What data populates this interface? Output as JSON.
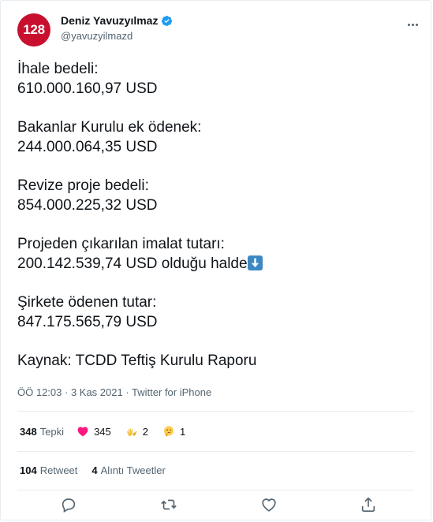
{
  "author": {
    "avatar_text": "128",
    "name": "Deniz Yavuzyılmaz",
    "handle": "@yavuzyilmazd"
  },
  "tweet": {
    "paragraphs": [
      "İhale bedeli:\n610.000.160,97 USD",
      "Bakanlar Kurulu ek ödenek:\n244.000.064,35 USD",
      "Revize proje bedeli:\n854.000.225,32 USD"
    ],
    "para4_line1": "Projeden çıkarılan imalat tutarı:",
    "para4_line2": "200.142.539,74 USD olduğu halde",
    "para5": "Şirkete ödenen tutar:\n847.175.565,79 USD",
    "para6": "Kaynak: TCDD Teftiş Kurulu Raporu"
  },
  "meta": {
    "time": "ÖÖ 12:03",
    "dot": " · ",
    "date": "3 Kas 2021",
    "source": "Twitter for iPhone"
  },
  "reactions": {
    "total_count": "348",
    "total_label": "Tepki",
    "heart_count": "345",
    "clap_count": "2",
    "thinking_count": "1"
  },
  "retweets": {
    "retweet_count": "104",
    "retweet_label": "Retweet",
    "quote_count": "4",
    "quote_label": "Alıntı Tweetler"
  },
  "colors": {
    "avatar_bg": "#c8102e",
    "verified": "#1d9bf0",
    "heart": "#f91880",
    "muted": "#536471",
    "arrow_emoji_bg": "#3b88c3"
  }
}
